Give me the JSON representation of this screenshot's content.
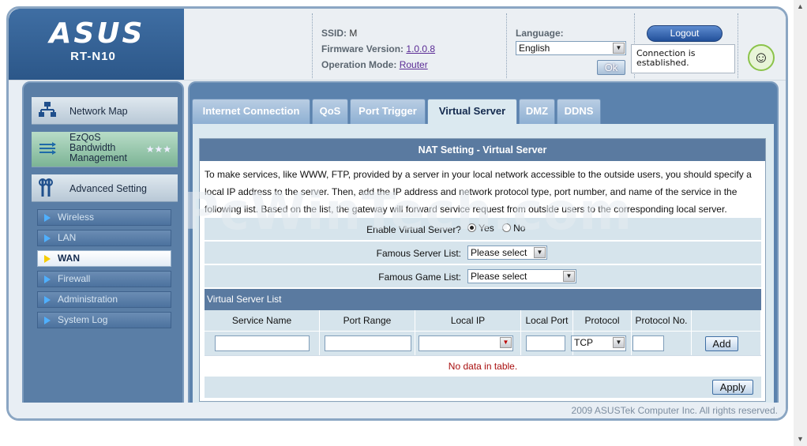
{
  "header": {
    "brand": "ASUS",
    "model": "RT-N10",
    "ssid_label": "SSID:",
    "ssid_value": "M",
    "firmware_label": "Firmware Version:",
    "firmware_value": "1.0.0.8",
    "mode_label": "Operation Mode:",
    "mode_value": "Router",
    "language_label": "Language:",
    "language_value": "English",
    "ok_label": "Ok",
    "logout_label": "Logout",
    "status_text": "Connection is established.",
    "avatar_icon": "assistant-face-icon"
  },
  "sidebar": {
    "main_items": [
      {
        "label": "Network Map",
        "icon": "network-map-icon"
      },
      {
        "label": "EzQoS Bandwidth Management",
        "icon": "ezqos-icon"
      },
      {
        "label": "Advanced Setting",
        "icon": "wrench-icon"
      }
    ],
    "sub_items": [
      {
        "label": "Wireless"
      },
      {
        "label": "LAN"
      },
      {
        "label": "WAN"
      },
      {
        "label": "Firewall"
      },
      {
        "label": "Administration"
      },
      {
        "label": "System Log"
      }
    ],
    "active_sub": "WAN"
  },
  "tabs": [
    {
      "label": "Internet Connection"
    },
    {
      "label": "QoS"
    },
    {
      "label": "Port Trigger"
    },
    {
      "label": "Virtual Server"
    },
    {
      "label": "DMZ"
    },
    {
      "label": "DDNS"
    }
  ],
  "active_tab": "Virtual Server",
  "form": {
    "title": "NAT Setting - Virtual Server",
    "description": "To make services, like WWW, FTP, provided by a server in your local network accessible to the outside users, you should specify a local IP address to the server. Then, add the IP address and network protocol type, port number, and name of the service in the following list. Based on the list, the gateway will forward service request from outside users to the corresponding local server.",
    "enable_label": "Enable Virtual Server?",
    "yes_label": "Yes",
    "no_label": "No",
    "enable_value": "Yes",
    "famous_server_label": "Famous Server List:",
    "famous_server_value": "Please select",
    "famous_game_label": "Famous Game List:",
    "famous_game_value": "Please select",
    "list_title": "Virtual Server List",
    "columns": [
      "Service Name",
      "Port Range",
      "Local IP",
      "Local Port",
      "Protocol",
      "Protocol No."
    ],
    "protocol_value": "TCP",
    "add_label": "Add",
    "no_data": "No data in table.",
    "apply_label": "Apply"
  },
  "watermark": "PcWinTech.com",
  "footer": "2009 ASUSTek Computer Inc. All rights reserved.",
  "colors": {
    "header_blue": "#2c5789",
    "panel_blue": "#5b82ad",
    "title_bar": "#5a7aa0",
    "row_bg": "#d6e4ec",
    "no_data_red": "#a80e0e"
  }
}
